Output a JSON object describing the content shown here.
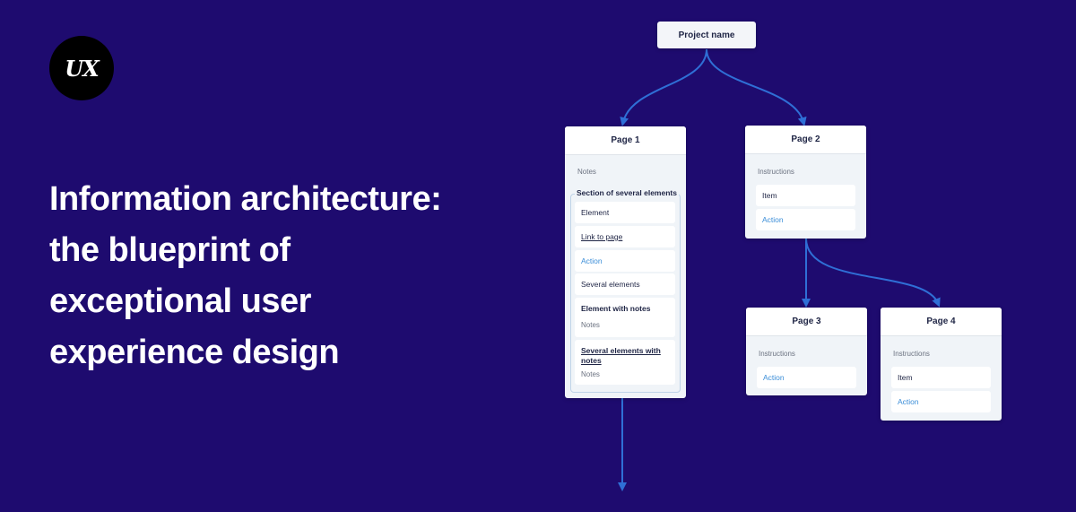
{
  "logo": {
    "text": "UX"
  },
  "headline": "Information architecture: the blueprint of exceptional user experience design",
  "colors": {
    "background": "#1e0b6f",
    "connector": "#2f6fd6",
    "action": "#3b8ed8",
    "card": "#f0f4f8"
  },
  "diagram": {
    "project": {
      "label": "Project name"
    },
    "page1": {
      "title": "Page 1",
      "notes": "Notes",
      "section_title": "Section of several elements",
      "items": {
        "element": "Element",
        "link": "Link to page",
        "action": "Action",
        "several": "Several elements",
        "with_notes_title": "Element with notes",
        "with_notes_note": "Notes",
        "several_notes_title": "Several elements with notes",
        "several_notes_note": "Notes"
      }
    },
    "page2": {
      "title": "Page 2",
      "instructions": "Instructions",
      "item": "Item",
      "action": "Action"
    },
    "page3": {
      "title": "Page 3",
      "instructions": "Instructions",
      "action": "Action"
    },
    "page4": {
      "title": "Page 4",
      "instructions": "Instructions",
      "item": "Item",
      "action": "Action"
    }
  }
}
